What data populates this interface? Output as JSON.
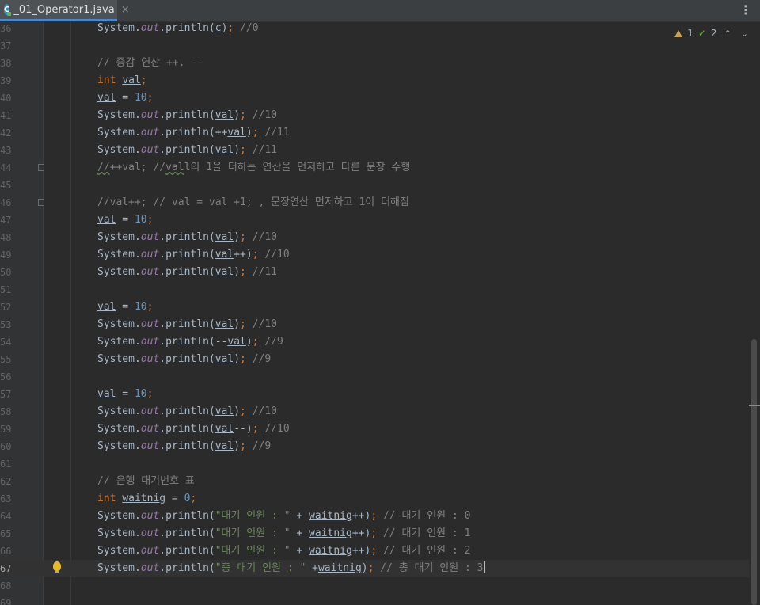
{
  "tab": {
    "title": "_01_Operator1.java",
    "close": "×",
    "icon_letter": "C"
  },
  "toolbar": {
    "more": "⋮"
  },
  "inspections": {
    "warnings": "1",
    "ok": "2",
    "prev": "⌃",
    "next": "⌄"
  },
  "colors": {
    "keyword": "#cc7832",
    "number": "#6897bb",
    "string": "#6a8759",
    "comment": "#808080",
    "field": "#9876aa",
    "text": "#a9b7c6",
    "background": "#2b2b2b"
  },
  "lines": [
    {
      "num": "36",
      "text": "System.out.println(c); //0"
    },
    {
      "num": "37",
      "text": ""
    },
    {
      "num": "38",
      "text": "// 증감 연산 ++. --"
    },
    {
      "num": "39",
      "text": "int val;"
    },
    {
      "num": "40",
      "text": "val = 10;"
    },
    {
      "num": "41",
      "text": "System.out.println(val); //10"
    },
    {
      "num": "42",
      "text": "System.out.println(++val); //11"
    },
    {
      "num": "43",
      "text": "System.out.println(val); //11"
    },
    {
      "num": "44",
      "text": "//++val; //val의 1을 더하는 연산을 먼저하고 다른 문장 수행"
    },
    {
      "num": "45",
      "text": ""
    },
    {
      "num": "46",
      "text": "//val++; // val = val +1; , 문장연산 먼저하고 1이 더해짐"
    },
    {
      "num": "47",
      "text": "val = 10;"
    },
    {
      "num": "48",
      "text": "System.out.println(val); //10"
    },
    {
      "num": "49",
      "text": "System.out.println(val++); //10"
    },
    {
      "num": "50",
      "text": "System.out.println(val); //11"
    },
    {
      "num": "51",
      "text": ""
    },
    {
      "num": "52",
      "text": "val = 10;"
    },
    {
      "num": "53",
      "text": "System.out.println(val); //10"
    },
    {
      "num": "54",
      "text": "System.out.println(--val); //9"
    },
    {
      "num": "55",
      "text": "System.out.println(val); //9"
    },
    {
      "num": "56",
      "text": ""
    },
    {
      "num": "57",
      "text": "val = 10;"
    },
    {
      "num": "58",
      "text": "System.out.println(val); //10"
    },
    {
      "num": "59",
      "text": "System.out.println(val--); //10"
    },
    {
      "num": "60",
      "text": "System.out.println(val); //9"
    },
    {
      "num": "61",
      "text": ""
    },
    {
      "num": "62",
      "text": "// 은행 대기번호 표"
    },
    {
      "num": "63",
      "text": "int waitnig = 0;"
    },
    {
      "num": "64",
      "text": "System.out.println(\"대기 인원 : \" + waitnig++); // 대기 인원 : 0"
    },
    {
      "num": "65",
      "text": "System.out.println(\"대기 인원 : \" + waitnig++); // 대기 인원 : 1"
    },
    {
      "num": "66",
      "text": "System.out.println(\"대기 인원 : \" + waitnig++); // 대기 인원 : 2"
    },
    {
      "num": "67",
      "text": "System.out.println(\"총 대기 인원 : \" +waitnig); // 총 대기 인원 : 3"
    },
    {
      "num": "68",
      "text": ""
    },
    {
      "num": "69",
      "text": ""
    }
  ],
  "current_line": "67",
  "fold_lines": [
    "44",
    "46"
  ],
  "intention_line": "67"
}
